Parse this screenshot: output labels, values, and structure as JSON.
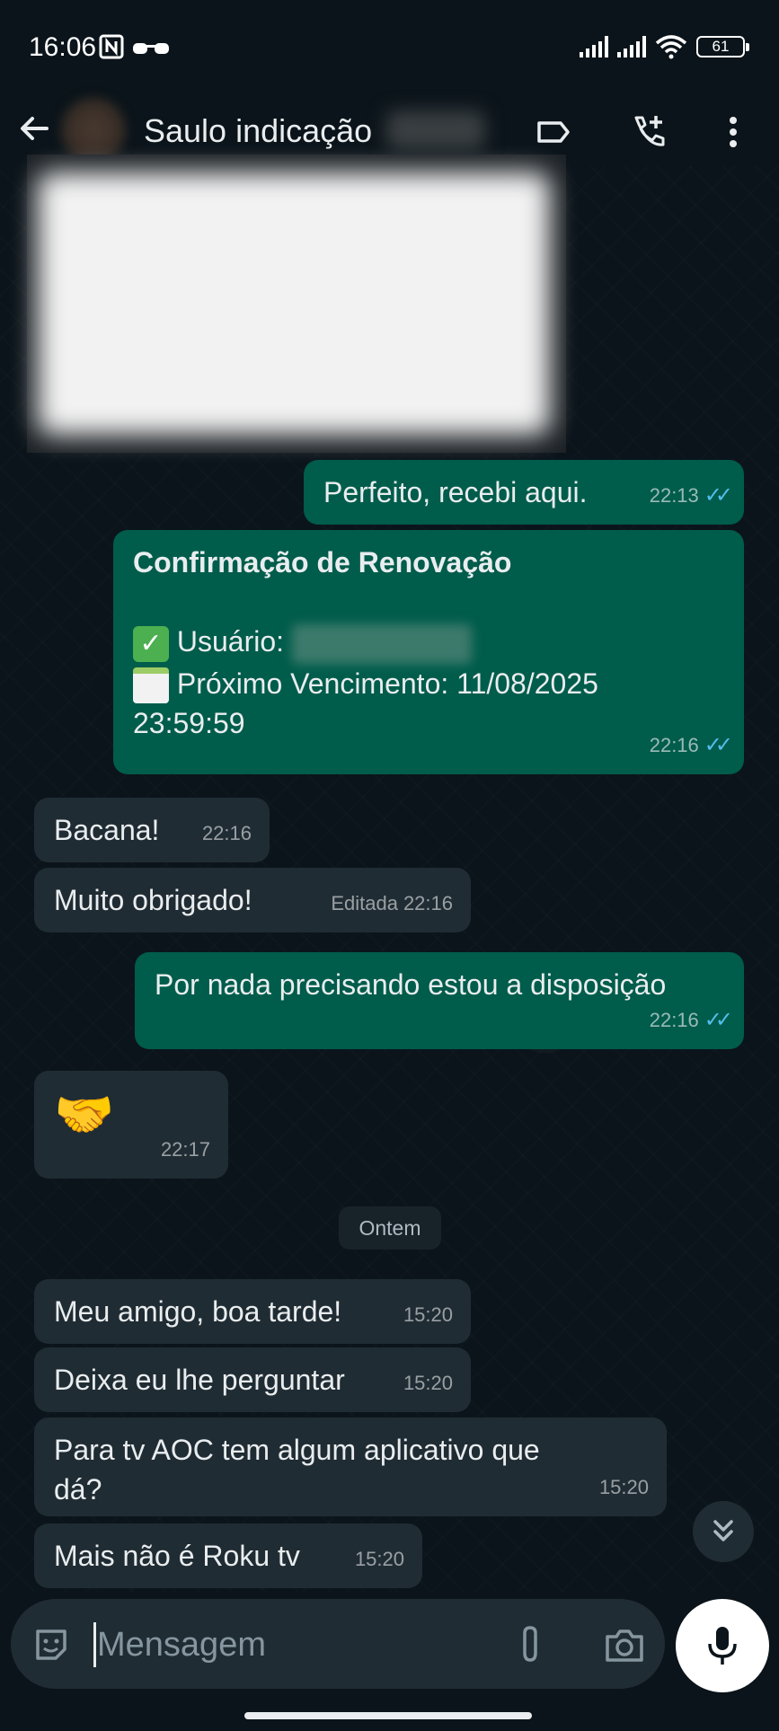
{
  "status_bar": {
    "time": "16:06",
    "battery": "61"
  },
  "header": {
    "contact_name": "Saulo indicação"
  },
  "messages": {
    "m1": {
      "text": "Perfeito, recebi aqui.",
      "time": "22:13"
    },
    "m2": {
      "title": "Confirmação de Renovação",
      "user_label": "Usuário:",
      "due_label": "Próximo Vencimento: 11/08/2025",
      "due_time": "23:59:59",
      "time": "22:16"
    },
    "m3": {
      "text": "Bacana!",
      "time": "22:16"
    },
    "m4": {
      "text": "Muito obrigado!",
      "edited": "Editada",
      "time": "22:16"
    },
    "m5": {
      "text": "Por nada precisando estou a disposição",
      "time": "22:16"
    },
    "m6": {
      "emoji": "🤝",
      "time": "22:17"
    },
    "date_divider": "Ontem",
    "m7": {
      "text": "Meu amigo, boa tarde!",
      "time": "15:20"
    },
    "m8": {
      "text": "Deixa eu lhe perguntar",
      "time": "15:20"
    },
    "m9": {
      "text": "Para tv AOC tem algum  aplicativo que dá?",
      "time": "15:20"
    },
    "m10": {
      "text": "Mais não é Roku tv",
      "time": "15:20"
    }
  },
  "composer": {
    "placeholder": "Mensagem"
  },
  "icons": {
    "back": "arrow-left-icon",
    "label": "label-icon",
    "add_call": "add-call-icon",
    "more": "more-vertical-icon",
    "sticker": "sticker-icon",
    "attach": "paperclip-icon",
    "camera": "camera-icon",
    "mic": "microphone-icon",
    "scroll_down": "double-chevron-down-icon"
  },
  "colors": {
    "outgoing": "#005c4b",
    "incoming": "#202c33",
    "read_ticks": "#53bdeb",
    "background": "#0b141a"
  }
}
